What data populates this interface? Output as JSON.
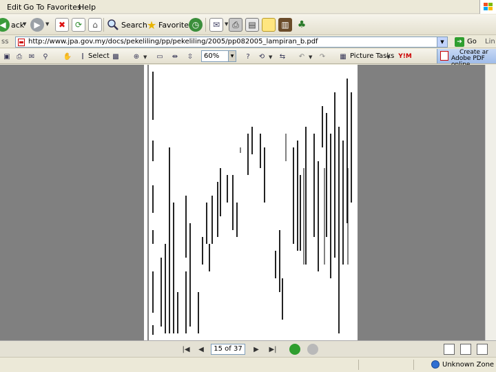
{
  "menu": {
    "items": [
      "Edit",
      "Go To",
      "Favorites",
      "Help"
    ]
  },
  "toolbar": {
    "back_label": "ack",
    "search_label": "Search",
    "favorites_label": "Favorites"
  },
  "address": {
    "label": "ss",
    "url": "http://www.jpa.gov.my/docs/pekeliling/pp/pekeliling/2005/pp082005_lampiran_b.pdf",
    "go_label": "Go",
    "links_label": "Lin"
  },
  "acrobat": {
    "select_label": "Select",
    "zoom_value": "60%",
    "picture_tasks_label": "Picture Tasks",
    "create_pdf_line1": "Create ar",
    "create_pdf_line2": "Adobe PDF online"
  },
  "navigation": {
    "page_display": "15 of 37"
  },
  "status": {
    "zone_label": "Unknown Zone"
  },
  "colors": {
    "doc_background": "#808080",
    "chrome": "#ece9d8",
    "accent_blue": "#2f6fd2"
  },
  "icons": [
    "back-icon",
    "forward-icon",
    "stop-icon",
    "refresh-icon",
    "home-icon",
    "search-icon",
    "favorites-icon",
    "history-icon",
    "mail-icon",
    "print-icon",
    "edit-icon",
    "messenger-icon",
    "save-icon",
    "hand-icon",
    "zoom-in-icon",
    "fit-page-icon",
    "rotate-icon",
    "undo-icon",
    "first-page-icon",
    "prev-page-icon",
    "next-page-icon",
    "last-page-icon",
    "prev-view-icon",
    "next-view-icon",
    "single-page-icon",
    "continuous-icon",
    "internet-zone-icon"
  ]
}
